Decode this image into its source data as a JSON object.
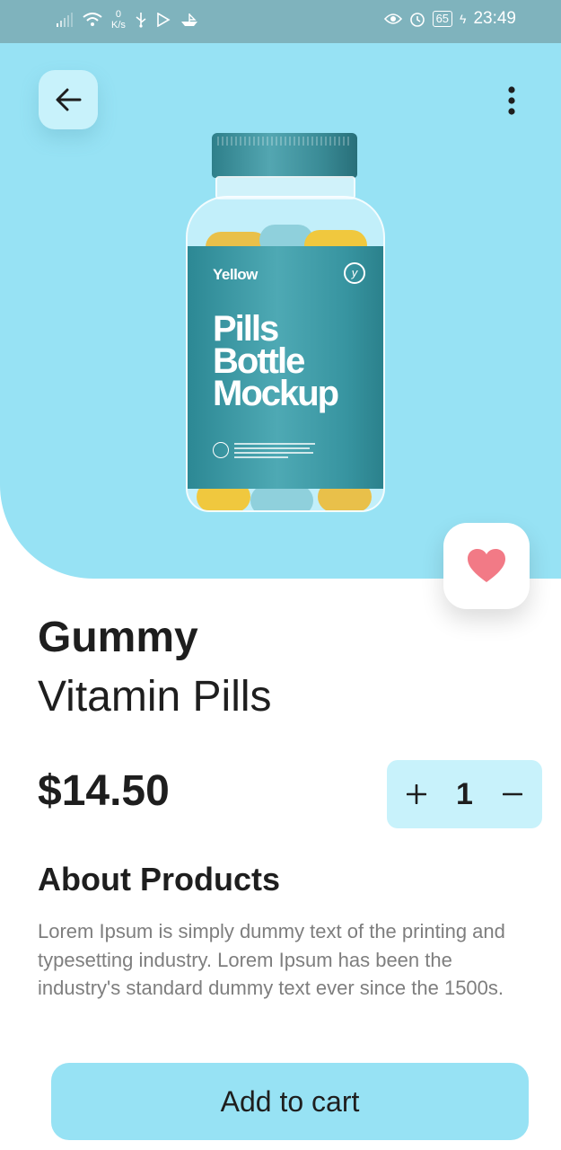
{
  "status_bar": {
    "speed_value": "0",
    "speed_unit": "K/s",
    "battery": "65",
    "time": "23:49"
  },
  "product_image": {
    "brand": "Yellow",
    "title_line1": "Pills",
    "title_line2": "Bottle",
    "title_line3": "Mockup"
  },
  "product": {
    "name_bold": "Gummy",
    "name_regular": "Vitamin Pills",
    "price": "$14.50",
    "quantity": "1"
  },
  "about": {
    "title": "About Products",
    "text": "Lorem Ipsum is simply dummy text of the printing and typesetting industry. Lorem Ipsum has been the industry's standard dummy text ever since the 1500s."
  },
  "actions": {
    "add_to_cart": "Add to cart"
  },
  "colors": {
    "hero_bg": "#97e2f4",
    "accent_light": "#c8f2fb",
    "heart": "#f27a86",
    "status_bar": "#7fb3bd"
  },
  "icons": {
    "back": "arrow-left-icon",
    "more": "more-vertical-icon",
    "favorite": "heart-icon",
    "plus": "plus-icon",
    "minus": "minus-icon"
  }
}
